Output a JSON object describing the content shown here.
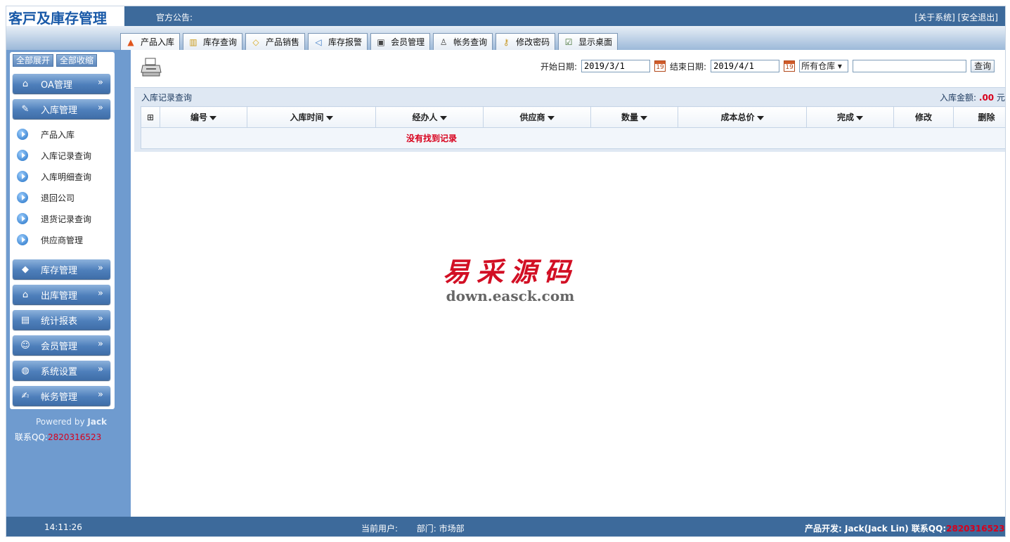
{
  "app": {
    "logo": "客戸及庫存管理",
    "notice_label": "官方公告:",
    "links": [
      "[关于系统]",
      "[安全退出]"
    ]
  },
  "tabs": [
    {
      "label": "产品入库",
      "icon": "house-arrow-icon"
    },
    {
      "label": "库存查询",
      "icon": "book-icon"
    },
    {
      "label": "产品销售",
      "icon": "tag-icon"
    },
    {
      "label": "库存报警",
      "icon": "speaker-icon"
    },
    {
      "label": "会员管理",
      "icon": "member-card-icon"
    },
    {
      "label": "帐务查询",
      "icon": "trash-bin-icon"
    },
    {
      "label": "修改密码",
      "icon": "key-icon"
    },
    {
      "label": "显示桌面",
      "icon": "desktop-icon"
    }
  ],
  "sidebar": {
    "expand_all": "全部展开",
    "collapse_all": "全部收缩",
    "arrow": "»",
    "categories": [
      {
        "label": "OA管理",
        "icon": "house-icon"
      },
      {
        "label": "入库管理",
        "icon": "pencil-icon"
      },
      {
        "label": "库存管理",
        "icon": "boxes-icon"
      },
      {
        "label": "出库管理",
        "icon": "house-out-icon"
      },
      {
        "label": "统计报表",
        "icon": "report-icon"
      },
      {
        "label": "会员管理",
        "icon": "smiley-icon"
      },
      {
        "label": "系统设置",
        "icon": "globe-icon"
      },
      {
        "label": "帐务管理",
        "icon": "ledger-icon"
      }
    ],
    "sub_items": [
      "产品入库",
      "入库记录查询",
      "入库明细查询",
      "退回公司",
      "退货记录查询",
      "供应商管理"
    ],
    "powered_prefix": "Powered by ",
    "powered_name": "Jack",
    "qq_label": "联系QQ:",
    "qq_number": "2820316523"
  },
  "filter": {
    "start_label": "开始日期:",
    "start_value": "2019/3/1",
    "end_label": "结束日期:",
    "end_value": "2019/4/1",
    "warehouse": "所有仓库 ▾",
    "query_button": "查询",
    "calendar_day": "19"
  },
  "grid": {
    "title": "入库记录查询",
    "amount_label": "入库金额:",
    "amount_value": ".00",
    "amount_unit": "元",
    "expand_symbol": "⊞",
    "columns": [
      "编号",
      "入库时间",
      "经办人",
      "供应商",
      "数量",
      "成本总价",
      "完成",
      "修改",
      "删除"
    ],
    "empty_text": "没有找到记录"
  },
  "watermark": {
    "cn": "易采源码",
    "url": "down.easck.com"
  },
  "footer": {
    "time": "14:11:26",
    "current_user_label": "当前用户:",
    "dept_label": "部门:",
    "dept_value": "市场部",
    "dev_label": "产品开发: Jack(Jack Lin)  联系QQ:",
    "dev_qq": "2820316523"
  }
}
